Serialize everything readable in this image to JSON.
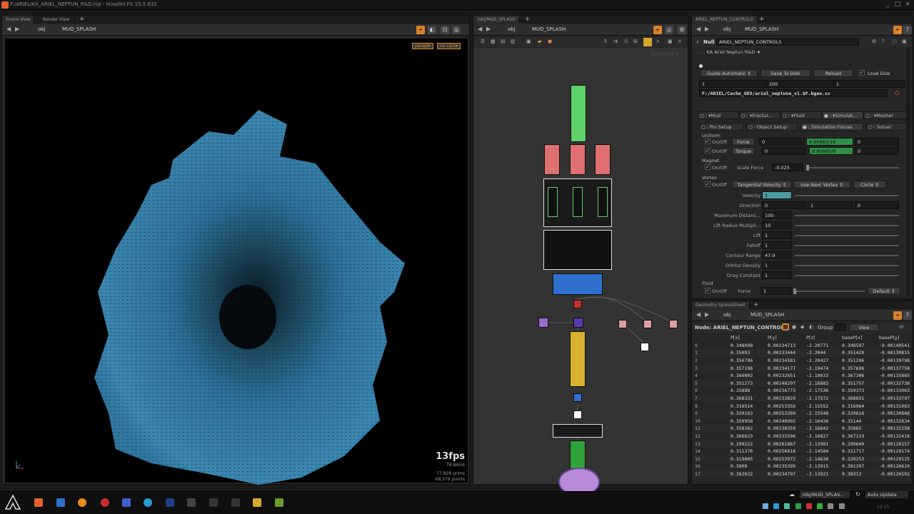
{
  "window": {
    "title": "F:/ARIEL/KA_ARIEL_NEPTUN_R&D.hip - Houdini FX 15.5.632"
  },
  "colors": {
    "accent": "#d9822b",
    "splash": "#3a87b0",
    "green_node": "#5fd16a",
    "pink_node": "#e07070",
    "blue_node": "#2f6fd0",
    "yellow_node": "#d8b22e"
  },
  "scene_view": {
    "tabs": [
      "Scene View",
      "Render View"
    ],
    "path_root": "obj",
    "path_node": "MUD_SPLASH",
    "camera_menu": "perspl▾",
    "cam_menu": "no cam▾",
    "fps": "13fps",
    "ms": "78.84ms",
    "prims": "77,828 prims",
    "points": "68,379 points"
  },
  "network_view": {
    "tab": "/obj/MUD_SPLASH",
    "path_root": "obj",
    "path_node": "MUD_SPLASH",
    "context_label": "Geometry"
  },
  "parameters": {
    "tab": "ARIEL_NEPTUN_CONTROLS",
    "path_root": "obj",
    "path_node": "MUD_SPLASH",
    "node_type": "Null",
    "node_name": "ARIEL_NEPTUN_CONTROLS",
    "header_text": "KA Ariel Neptun R&D ★",
    "guide_menu": "Guide Automatic",
    "save_btn": "Save To Disk",
    "reload_btn": "Reload",
    "load_disk": "Load Disk",
    "frame_start": "1",
    "frame_end": "200",
    "frame_inc": "1",
    "cache_path": "F:/ARIEL/Cache_GEO/ariel_neptune_v1.$F.bgeo.sc",
    "main_tabs": [
      "Mud",
      "Fractur...",
      "Fluid",
      "Simulat...",
      "Mesher"
    ],
    "sub_tabs": [
      "Pin Setup",
      "Object Setup",
      "Simulation Forces",
      "Solver"
    ],
    "uniform": {
      "label": "Uniform",
      "onoff": "On/Off",
      "force_lbl": "Force",
      "force": [
        "0",
        "9.80665/16",
        "0"
      ],
      "torque_lbl": "Torque",
      "torque": [
        "0",
        "9.80665/8",
        "0"
      ]
    },
    "magnet": {
      "label": "Magnet",
      "onoff": "On/Off",
      "scale_lbl": "Scale Force",
      "scale": "-0.025"
    },
    "vortex": {
      "label": "Vortex",
      "onoff": "On/Off",
      "type_menu": "Tangential Velocity",
      "next_menu": "Use Next Vertex",
      "shape_menu": "Circle",
      "rows": [
        {
          "label": "Velocity",
          "value": "1"
        },
        {
          "label": "Direction",
          "value": "0",
          "v2": "1",
          "v3": "0"
        },
        {
          "label": "Maximum Distanc...",
          "value": "100"
        },
        {
          "label": "Lift Radius Multipli...",
          "value": "10"
        },
        {
          "label": "Lift",
          "value": "1"
        },
        {
          "label": "Falloff",
          "value": "1"
        },
        {
          "label": "Contour Range",
          "value": "47.9"
        },
        {
          "label": "Orbital Density",
          "value": "1"
        },
        {
          "label": "Drag Constant",
          "value": "1"
        }
      ]
    },
    "fluid": {
      "label": "Fluid",
      "onoff": "On/Off",
      "force_lbl": "Force",
      "force": "1",
      "menu": "Default"
    }
  },
  "spreadsheet": {
    "tab": "Geometry Spreadsheet",
    "path_root": "obj",
    "path_node": "MUD_SPLASH",
    "node_label": "Node: ARIEL_NEPTUN_CONTROLS",
    "group_label": "Group",
    "view_label": "View",
    "columns": [
      "",
      "P[x]",
      "P[y]",
      "P[z]",
      "baseP[x]",
      "baseP[y]"
    ],
    "rows": [
      [
        "0",
        "0.348098",
        "0.00234713",
        "-2.20771",
        "0.348597",
        "-0.00140541"
      ],
      [
        "1",
        "0.35093",
        "0.00233444",
        "-2.2044",
        "0.351429",
        "-0.00139815"
      ],
      [
        "2",
        "0.350796",
        "0.00234581",
        "-2.20427",
        "0.351296",
        "-0.00139798"
      ],
      [
        "3",
        "0.357196",
        "0.00234177",
        "-2.19474",
        "0.357696",
        "-0.00137758"
      ],
      [
        "4",
        "0.366802",
        "0.00232651",
        "-2.18633",
        "0.367306",
        "-0.00135865"
      ],
      [
        "5",
        "0.351273",
        "0.00240297",
        "-2.16803",
        "0.351757",
        "-0.00132730"
      ],
      [
        "6",
        "0.35888",
        "0.00236773",
        "-2.17536",
        "0.359373",
        "-0.00133963"
      ],
      [
        "7",
        "0.368331",
        "0.00233829",
        "-2.17572",
        "0.368831",
        "-0.00133797"
      ],
      [
        "8",
        "0.316514",
        "0.00253356",
        "-2.15552",
        "0.316964",
        "-0.00131083"
      ],
      [
        "9",
        "0.320163",
        "0.00252289",
        "-2.15548",
        "0.320616",
        "-0.00130848"
      ],
      [
        "10",
        "0.350958",
        "0.00240992",
        "-2.16438",
        "0.35144",
        "-0.00132834"
      ],
      [
        "11",
        "0.358362",
        "0.00238359",
        "-2.16642",
        "0.35865",
        "-0.00132258"
      ],
      [
        "12",
        "0.366623",
        "0.00235506",
        "-2.16827",
        "0.367119",
        "-0.00132418"
      ],
      [
        "13",
        "0.299222",
        "0.00261867",
        "-2.13981",
        "0.299649",
        "-0.00128157"
      ],
      [
        "14",
        "0.311276",
        "0.00256818",
        "-2.14584",
        "0.311717",
        "-0.00129174"
      ],
      [
        "15",
        "0.319805",
        "0.00253972",
        "-2.14638",
        "0.320253",
        "-0.00129125"
      ],
      [
        "16",
        "0.3808",
        "0.00235399",
        "-2.13915",
        "0.381297",
        "-0.00126610"
      ],
      [
        "17",
        "0.382622",
        "0.00234797",
        "-2.13921",
        "0.38312",
        "-0.00126592"
      ]
    ]
  },
  "status": {
    "path": "/obj/MUD_SPLAS...",
    "auto_update": "Auto Update",
    "clock": "22:15"
  }
}
